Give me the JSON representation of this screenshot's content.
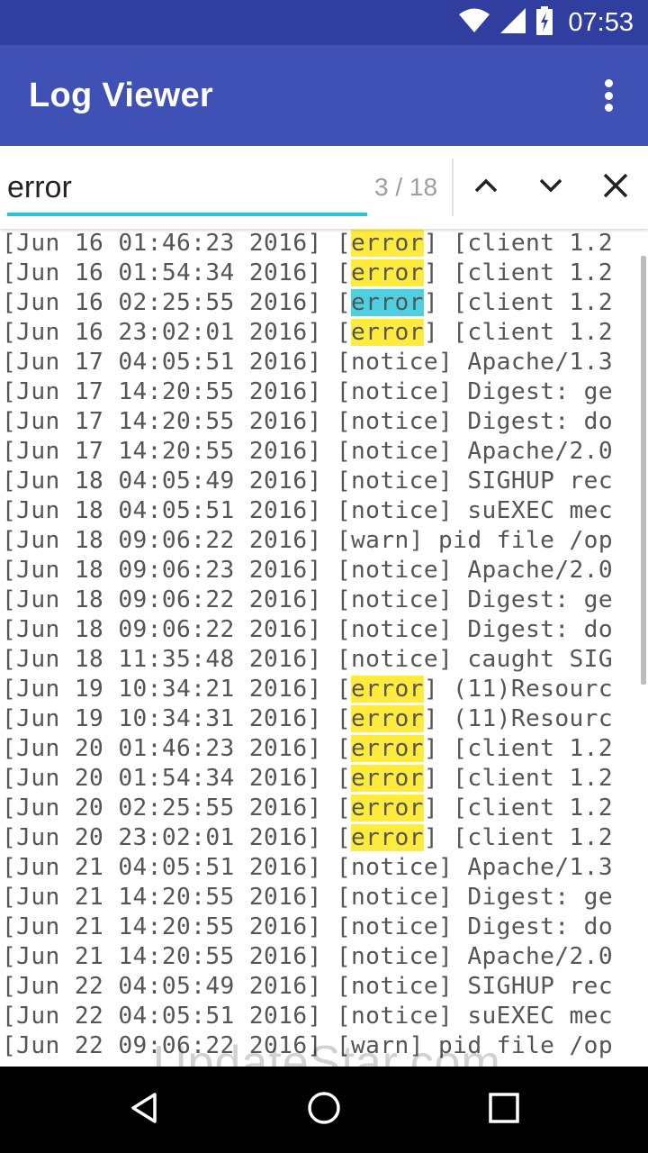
{
  "status_bar": {
    "time": "07:53",
    "icons": [
      "wifi-icon",
      "cell-signal-icon",
      "battery-charging-icon"
    ]
  },
  "app_bar": {
    "title": "Log Viewer",
    "menu_icon": "more-vert-icon"
  },
  "search": {
    "query": "error",
    "match_count": "3 / 18",
    "buttons": [
      "previous-match",
      "next-match",
      "close-search"
    ],
    "accent_color": "#26C6DA"
  },
  "colors": {
    "status_bar": "#303F9F",
    "app_bar": "#3F51B5",
    "highlight": "#FFEB3B",
    "current_highlight": "#4DD0E1"
  },
  "log_lines": [
    {
      "pre": "[Jun 16 01:46:23 2016] [",
      "match": "error",
      "post": "] [client 1.2",
      "current": false
    },
    {
      "pre": "[Jun 16 01:54:34 2016] [",
      "match": "error",
      "post": "] [client 1.2",
      "current": false
    },
    {
      "pre": "[Jun 16 02:25:55 2016] [",
      "match": "error",
      "post": "] [client 1.2",
      "current": true
    },
    {
      "pre": "[Jun 16 23:02:01 2016] [",
      "match": "error",
      "post": "] [client 1.2",
      "current": false
    },
    {
      "pre": "[Jun 17 04:05:51 2016] [notice] Apache/1.3"
    },
    {
      "pre": "[Jun 17 14:20:55 2016] [notice] Digest: ge"
    },
    {
      "pre": "[Jun 17 14:20:55 2016] [notice] Digest: do"
    },
    {
      "pre": "[Jun 17 14:20:55 2016] [notice] Apache/2.0"
    },
    {
      "pre": "[Jun 18 04:05:49 2016] [notice] SIGHUP rec"
    },
    {
      "pre": "[Jun 18 04:05:51 2016] [notice] suEXEC mec"
    },
    {
      "pre": "[Jun 18 09:06:22 2016] [warn] pid file /op"
    },
    {
      "pre": "[Jun 18 09:06:23 2016] [notice] Apache/2.0"
    },
    {
      "pre": "[Jun 18 09:06:22 2016] [notice] Digest: ge"
    },
    {
      "pre": "[Jun 18 09:06:22 2016] [notice] Digest: do"
    },
    {
      "pre": "[Jun 18 11:35:48 2016] [notice] caught SIG"
    },
    {
      "pre": "[Jun 19 10:34:21 2016] [",
      "match": "error",
      "post": "] (11)Resourc",
      "current": false
    },
    {
      "pre": "[Jun 19 10:34:31 2016] [",
      "match": "error",
      "post": "] (11)Resourc",
      "current": false
    },
    {
      "pre": "[Jun 20 01:46:23 2016] [",
      "match": "error",
      "post": "] [client 1.2",
      "current": false
    },
    {
      "pre": "[Jun 20 01:54:34 2016] [",
      "match": "error",
      "post": "] [client 1.2",
      "current": false
    },
    {
      "pre": "[Jun 20 02:25:55 2016] [",
      "match": "error",
      "post": "] [client 1.2",
      "current": false
    },
    {
      "pre": "[Jun 20 23:02:01 2016] [",
      "match": "error",
      "post": "] [client 1.2",
      "current": false
    },
    {
      "pre": "[Jun 21 04:05:51 2016] [notice] Apache/1.3"
    },
    {
      "pre": "[Jun 21 14:20:55 2016] [notice] Digest: ge"
    },
    {
      "pre": "[Jun 21 14:20:55 2016] [notice] Digest: do"
    },
    {
      "pre": "[Jun 21 14:20:55 2016] [notice] Apache/2.0"
    },
    {
      "pre": "[Jun 22 04:05:49 2016] [notice] SIGHUP rec"
    },
    {
      "pre": "[Jun 22 04:05:51 2016] [notice] suEXEC mec"
    },
    {
      "pre": "[Jun 22 09:06:22 2016] [warn] pid file /op"
    }
  ],
  "watermark": "UpdateStar.com",
  "nav_bar": {
    "buttons": [
      "back-icon",
      "home-icon",
      "recents-icon"
    ]
  }
}
